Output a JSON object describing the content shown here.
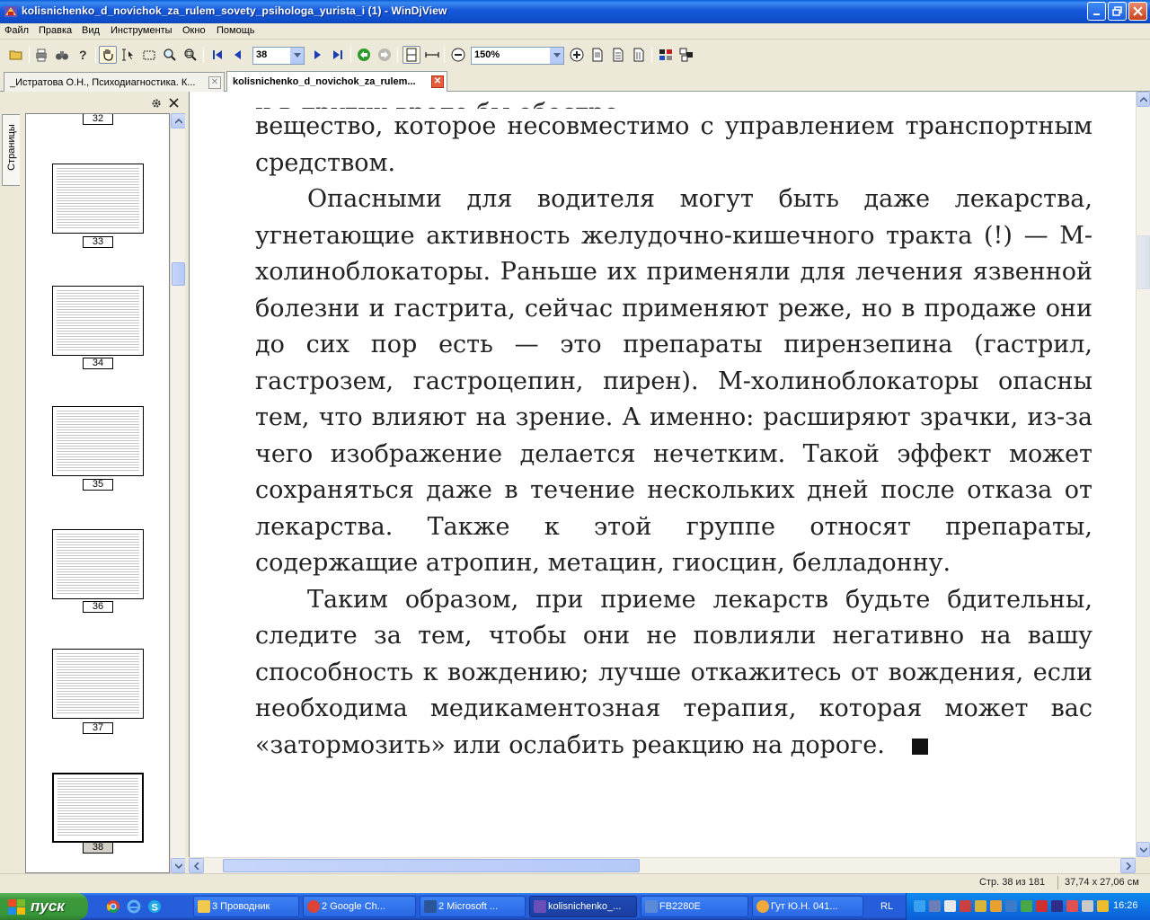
{
  "window": {
    "title": "kolisnichenko_d_novichok_za_rulem_sovety_psihologa_yurista_i (1) - WinDjView"
  },
  "menu": [
    "Файл",
    "Правка",
    "Вид",
    "Инструменты",
    "Окно",
    "Помощь"
  ],
  "toolbar": {
    "page_value": "38",
    "zoom_value": "150%"
  },
  "tabs": [
    {
      "label": "_Истратова О.Н., Психодиагностика. К..."
    },
    {
      "label": "kolisnichenko_d_novichok_za_rulem..."
    }
  ],
  "sidebar": {
    "tab_label": "Страницы",
    "thumbnails": [
      {
        "page": "32"
      },
      {
        "page": "33"
      },
      {
        "page": "34"
      },
      {
        "page": "35"
      },
      {
        "page": "36"
      },
      {
        "page": "37"
      },
      {
        "page": "38"
      }
    ]
  },
  "document": {
    "cut_line": "и в других вроде бы обостре...",
    "p1": "вещество, которое несовместимо с управлением транспортным средством.",
    "p2": "Опасными для водителя могут быть даже лекарства, угнетающие активность желудочно-кишечного тракта (!) — М-холиноблокаторы. Раньше их применяли для лечения язвенной болезни и гастрита, сейчас применяют реже, но в продаже они до сих пор есть — это препараты пирензепина (гастрил, гастрозем, гастроцепин, пирен). М-холиноблокаторы опасны тем, что влияют на зрение. А именно: расширяют зрачки, из-за чего изображение делается нечетким. Такой эффект может сохраняться даже в течение нескольких дней после отказа от лекарства. Также к этой группе относят препараты, содержащие атропин, метацин, гиосцин, белладонну.",
    "p3": "Таким образом, при приеме лекарств будьте бдительны, следите за тем, чтобы они не повлияли негативно на вашу способность к вождению; лучше откажитесь от вождения, если необходима медикаментозная терапия, которая может вас «затормозить» или ослабить реакцию на дороге."
  },
  "status": {
    "page_info": "Стр. 38 из 181",
    "size_info": "37,74 x 27,06 см"
  },
  "taskbar": {
    "start_label": "пуск",
    "buttons": [
      {
        "label": "3 Проводник"
      },
      {
        "label": "2 Google Ch..."
      },
      {
        "label": "2 Microsoft ..."
      },
      {
        "label": "kolisnichenko_..."
      },
      {
        "label": "FB2280E"
      },
      {
        "label": "Гут Ю.Н. 041..."
      }
    ],
    "lang": "RL",
    "clock": "16:26"
  }
}
